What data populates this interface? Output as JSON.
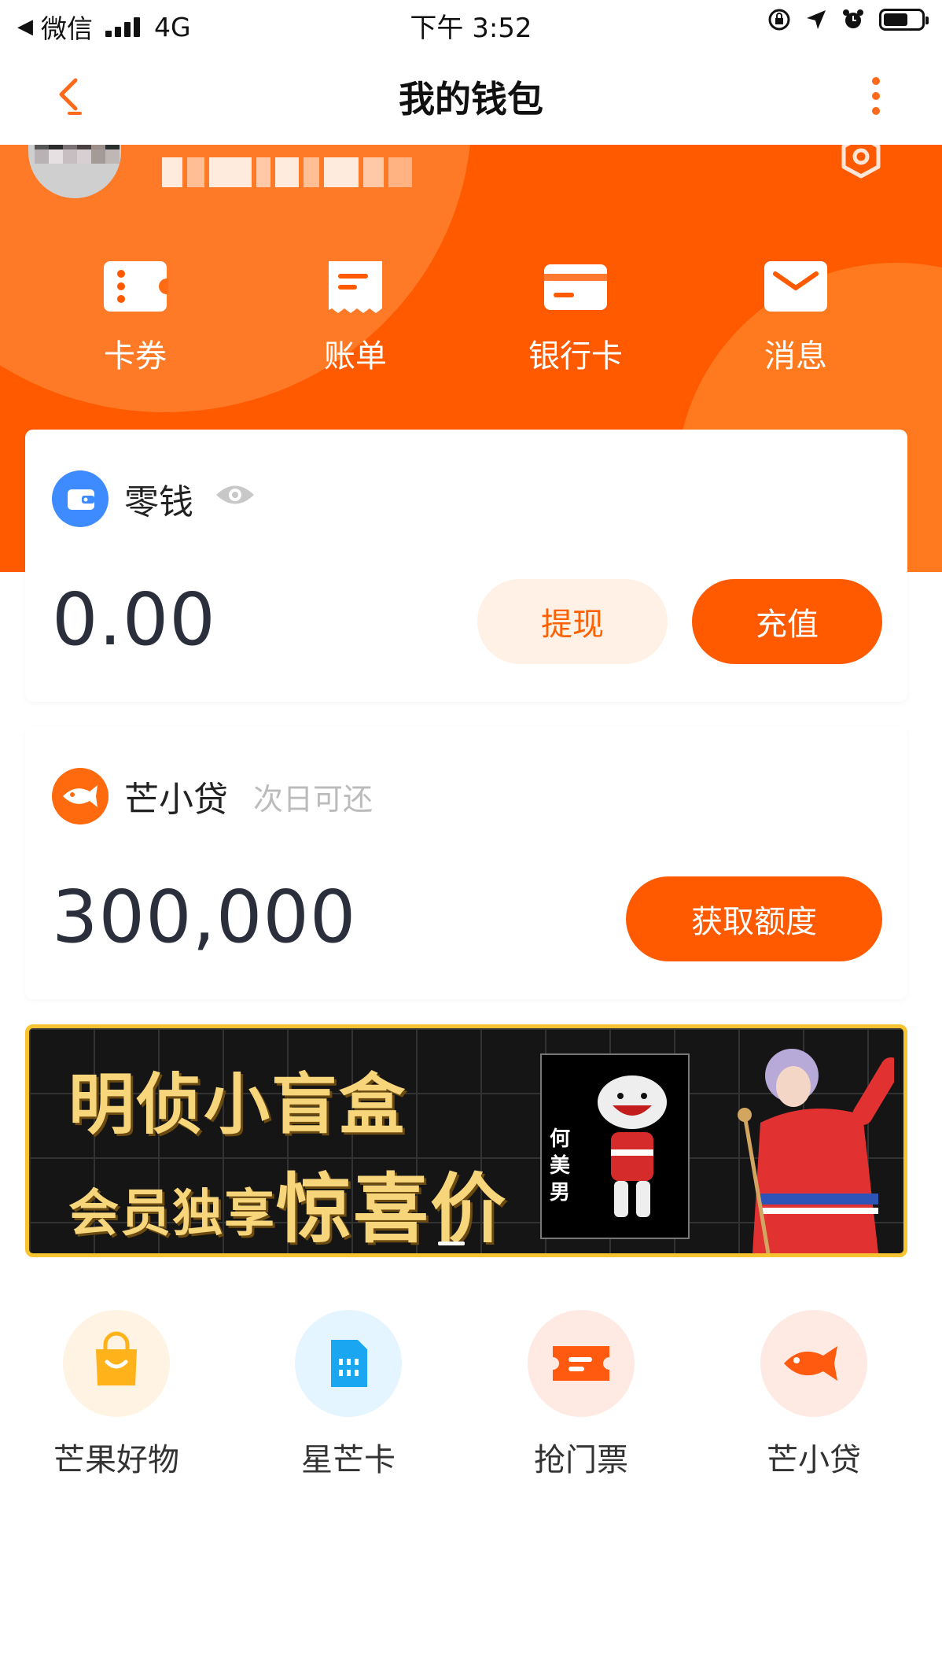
{
  "status_bar": {
    "carrier": "微信",
    "network": "4G",
    "time": "下午 3:52"
  },
  "nav": {
    "title": "我的钱包"
  },
  "features": [
    {
      "label": "卡券",
      "icon": "coupon-icon"
    },
    {
      "label": "账单",
      "icon": "bill-icon"
    },
    {
      "label": "银行卡",
      "icon": "bank-card-icon"
    },
    {
      "label": "消息",
      "icon": "message-icon"
    }
  ],
  "balance_card": {
    "title": "零钱",
    "amount": "0.00",
    "withdraw_label": "提现",
    "recharge_label": "充值"
  },
  "loan_card": {
    "title": "芒小贷",
    "subtitle": "次日可还",
    "amount": "300,000",
    "action_label": "获取额度"
  },
  "banner": {
    "line1": "明侦小盲盒",
    "line2_prefix": "会员独享",
    "line2_emphasis": "惊喜价",
    "box_name": "何美男"
  },
  "services": [
    {
      "label": "芒果好物",
      "icon": "shopping-bag-icon"
    },
    {
      "label": "星芒卡",
      "icon": "sim-card-icon"
    },
    {
      "label": "抢门票",
      "icon": "ticket-icon"
    },
    {
      "label": "芒小贷",
      "icon": "fish-icon"
    }
  ],
  "colors": {
    "brand_orange": "#ff5a00",
    "wallet_blue": "#3d8bff",
    "banner_border": "#f6c431"
  }
}
